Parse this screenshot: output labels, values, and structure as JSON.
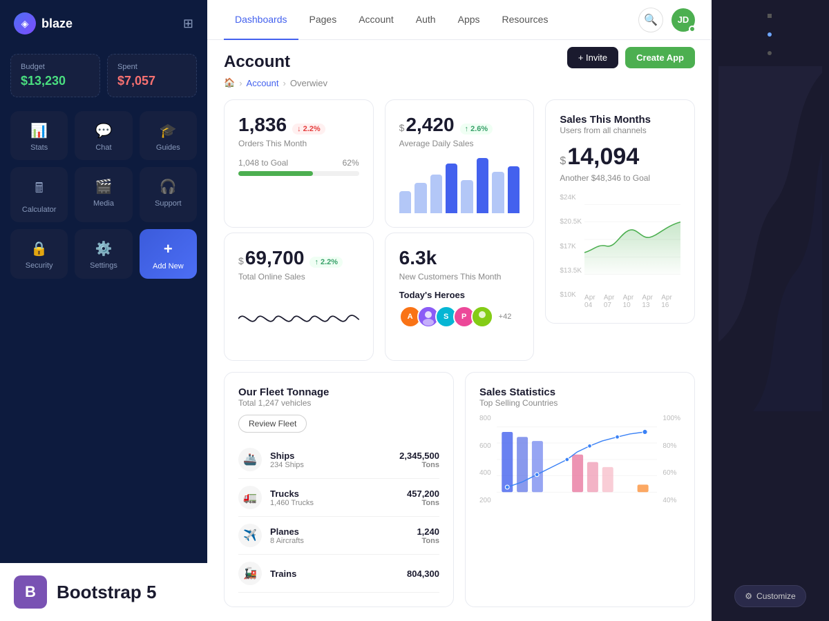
{
  "sidebar": {
    "logo": "blaze",
    "budget": {
      "label": "Budget",
      "value": "$13,230",
      "color": "green"
    },
    "spent": {
      "label": "Spent",
      "value": "$7,057",
      "color": "red"
    },
    "nav_items": [
      {
        "id": "stats",
        "label": "Stats",
        "icon": "📊"
      },
      {
        "id": "chat",
        "label": "Chat",
        "icon": "💬"
      },
      {
        "id": "guides",
        "label": "Guides",
        "icon": "🎓"
      },
      {
        "id": "calculator",
        "label": "Calculator",
        "icon": "🖩"
      },
      {
        "id": "media",
        "label": "Media",
        "icon": "🎬"
      },
      {
        "id": "support",
        "label": "Support",
        "icon": "🎧"
      },
      {
        "id": "security",
        "label": "Security",
        "icon": "🔒"
      },
      {
        "id": "settings",
        "label": "Settings",
        "icon": "⚙️"
      },
      {
        "id": "add_new",
        "label": "Add New",
        "icon": "+"
      }
    ],
    "bootstrap": {
      "label": "Bootstrap 5",
      "icon": "B"
    }
  },
  "top_nav": {
    "items": [
      {
        "id": "dashboards",
        "label": "Dashboards",
        "active": true
      },
      {
        "id": "pages",
        "label": "Pages"
      },
      {
        "id": "account",
        "label": "Account"
      },
      {
        "id": "auth",
        "label": "Auth"
      },
      {
        "id": "apps",
        "label": "Apps"
      },
      {
        "id": "resources",
        "label": "Resources"
      }
    ]
  },
  "page": {
    "title": "Account",
    "breadcrumb": [
      "Home",
      "Account",
      "Overwiev"
    ],
    "actions": {
      "invite_label": "+ Invite",
      "create_label": "Create App"
    }
  },
  "stats": {
    "orders": {
      "value": "1,836",
      "label": "Orders This Month",
      "badge": "↓ 2.2%",
      "badge_type": "down",
      "progress_label": "1,048 to Goal",
      "progress_pct": "62%",
      "progress_val": 62
    },
    "daily_sales": {
      "prefix": "$",
      "value": "2,420",
      "label": "Average Daily Sales",
      "badge": "↑ 2.6%",
      "badge_type": "up"
    },
    "total_sales": {
      "prefix": "$",
      "value": "69,700",
      "label": "Total Online Sales",
      "badge": "↑ 2.2%",
      "badge_type": "up"
    },
    "customers": {
      "value": "6.3k",
      "label": "New Customers This Month"
    },
    "sales_month": {
      "title": "Sales This Months",
      "subtitle": "Users from all channels",
      "prefix": "$",
      "big_value": "14,094",
      "goal_text": "Another $48,346 to Goal",
      "y_labels": [
        "$24K",
        "$20.5K",
        "$17K",
        "$13.5K",
        "$10K"
      ],
      "x_labels": [
        "Apr 04",
        "Apr 07",
        "Apr 10",
        "Apr 13",
        "Apr 16"
      ]
    }
  },
  "heroes": {
    "label": "Today's Heroes",
    "count": "+42",
    "avatars": [
      {
        "color": "#f97316",
        "initial": "A"
      },
      {
        "color": "#8b5cf6",
        "initial": ""
      },
      {
        "color": "#06b6d4",
        "initial": "S"
      },
      {
        "color": "#ec4899",
        "initial": "P"
      },
      {
        "color": "#84cc16",
        "initial": ""
      }
    ]
  },
  "fleet": {
    "title": "Our Fleet Tonnage",
    "subtitle": "Total 1,247 vehicles",
    "review_btn": "Review Fleet",
    "items": [
      {
        "icon": "🚢",
        "name": "Ships",
        "sub": "234 Ships",
        "value": "2,345,500",
        "unit": "Tons"
      },
      {
        "icon": "🚛",
        "name": "Trucks",
        "sub": "1,460 Trucks",
        "value": "457,200",
        "unit": "Tons"
      },
      {
        "icon": "✈️",
        "name": "Planes",
        "sub": "8 Aircrafts",
        "value": "1,240",
        "unit": "Tons"
      },
      {
        "icon": "🚂",
        "name": "Trains",
        "sub": "",
        "value": "804,300",
        "unit": ""
      }
    ]
  },
  "sales_stats": {
    "title": "Sales Statistics",
    "subtitle": "Top Selling Countries",
    "y_labels": [
      "800",
      "600",
      "400",
      "200"
    ],
    "pct_labels": [
      "100%",
      "80%",
      "60%",
      "40%"
    ]
  },
  "customize_btn": "Customize"
}
